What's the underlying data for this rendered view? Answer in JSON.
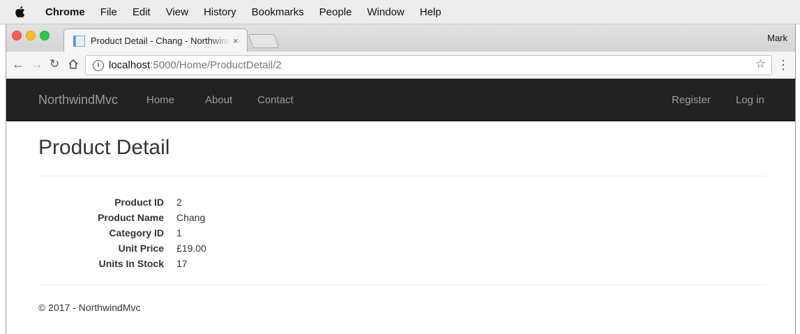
{
  "menubar": {
    "app": "Chrome",
    "items": [
      "File",
      "Edit",
      "View",
      "History",
      "Bookmarks",
      "People",
      "Window",
      "Help"
    ]
  },
  "browser": {
    "tab_title": "Product Detail - Chang - Northwind",
    "tab_close": "×",
    "profile_name": "Mark",
    "url_host": "localhost",
    "url_path": ":5000/Home/ProductDetail/2",
    "icons": [
      "back-arrow-icon",
      "forward-arrow-icon",
      "reload-icon",
      "home-icon",
      "info-icon",
      "star-icon",
      "menu-dots-icon"
    ]
  },
  "site_nav": {
    "brand": "NorthwindMvc",
    "links": [
      "Home",
      "About",
      "Contact"
    ],
    "register": "Register",
    "login": "Log in"
  },
  "page": {
    "title": "Product Detail",
    "details": [
      {
        "label": "Product ID",
        "value": "2"
      },
      {
        "label": "Product Name",
        "value": "Chang"
      },
      {
        "label": "Category ID",
        "value": "1"
      },
      {
        "label": "Unit Price",
        "value": "£19.00"
      },
      {
        "label": "Units In Stock",
        "value": "17"
      }
    ],
    "footer": "© 2017 - NorthwindMvc"
  },
  "colors": {
    "navbar_bg": "#222222",
    "navbar_text": "#9d9d9d",
    "traffic_red": "#fc5f57",
    "traffic_yellow": "#fdbc2e",
    "traffic_green": "#33c748"
  }
}
